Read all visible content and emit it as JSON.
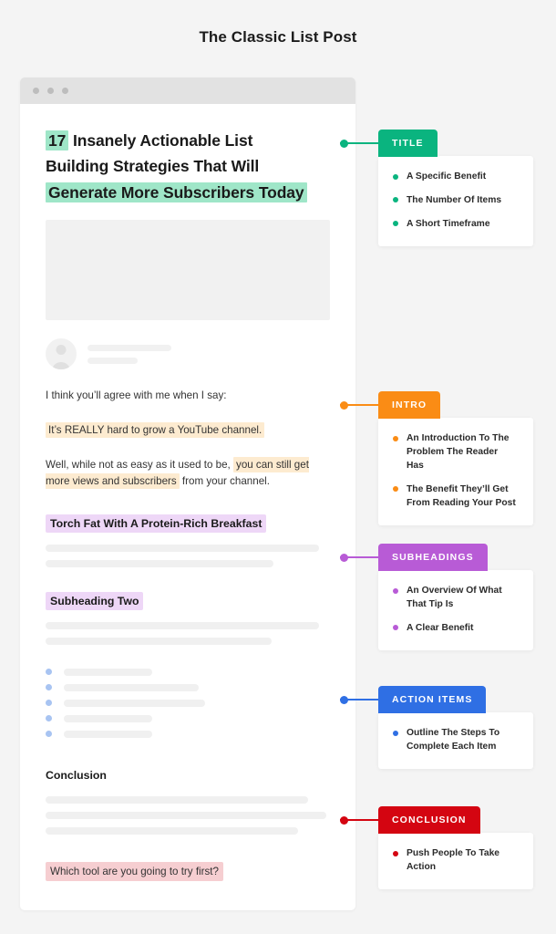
{
  "page": {
    "title": "The Classic List Post",
    "background": "#f4f4f4"
  },
  "browser": {
    "dots": [
      "window-dot-1",
      "window-dot-2",
      "window-dot-3"
    ]
  },
  "article": {
    "headline": {
      "line1_highlight": "17",
      "line1_rest": " Insanely Actionable List",
      "line2": "Building Strategies That Will",
      "line3_highlight": "Generate More Subscribers Today"
    },
    "intro_paragraph": "I think you’ll agree with me when I say:",
    "problem_paragraph": "It’s REALLY hard to grow a YouTube channel.",
    "benefit_paragraph_pre": "Well, while not as easy as it used to be, ",
    "benefit_paragraph_highlight": "you can still get more views and subscribers",
    "benefit_paragraph_post": " from your channel.",
    "subheading_one": "Torch Fat With A Protein-Rich Breakfast",
    "subheading_two": "Subheading Two",
    "conclusion_heading": "Conclusion",
    "closing_question": "Which tool are you going to try first?"
  },
  "callouts": [
    {
      "label": "TITLE",
      "color": "#0ab47f",
      "items": [
        "A Specific Benefit",
        "The Number Of Items",
        "A Short Timeframe"
      ]
    },
    {
      "label": "INTRO",
      "color": "#fa8c15",
      "items": [
        "An Introduction To The Problem The Reader Has",
        "The Benefit They’ll Get From Reading Your Post"
      ]
    },
    {
      "label": "SUBHEADINGS",
      "color": "#b85bd6",
      "items": [
        "An Overview Of What That Tip Is",
        "A Clear Benefit"
      ]
    },
    {
      "label": "ACTION ITEMS",
      "color": "#2f6fe4",
      "items": [
        "Outline The Steps To Complete Each Item"
      ]
    },
    {
      "label": "CONCLUSION",
      "color": "#d40511",
      "items": [
        "Push People To Take Action"
      ]
    }
  ],
  "highlight_colors": {
    "title_mint": "#9fe6c8",
    "intro_orange": "#fdebd0",
    "subheading_purple": "#eed7f7",
    "conclusion_pink": "#f6ced1",
    "action_bullet_blue": "#a8c4f2"
  }
}
